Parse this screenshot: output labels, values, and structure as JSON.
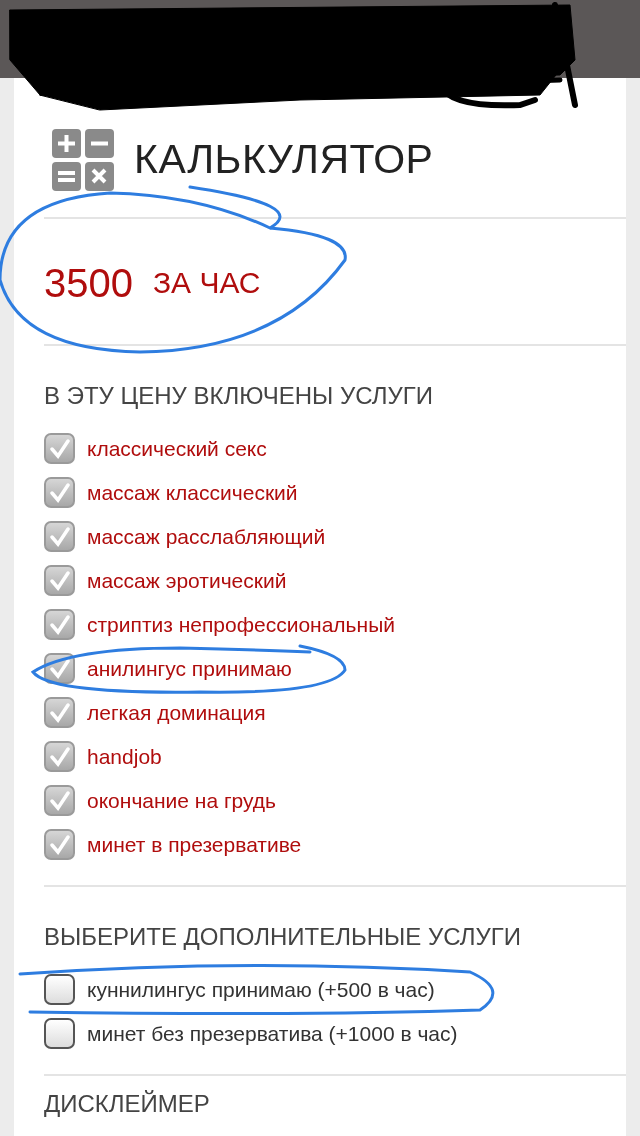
{
  "header": {
    "title": "КАЛЬКУЛЯТОР"
  },
  "price": {
    "amount": "3500",
    "unit": "ЗА ЧАС"
  },
  "included": {
    "heading": "В ЭТУ ЦЕНУ ВКЛЮЧЕНЫ УСЛУГИ",
    "items": [
      {
        "label": "классический секс",
        "checked": true
      },
      {
        "label": "массаж классический",
        "checked": true
      },
      {
        "label": "массаж расслабляющий",
        "checked": true
      },
      {
        "label": "массаж эротический",
        "checked": true
      },
      {
        "label": "стриптиз непрофессиональный",
        "checked": true
      },
      {
        "label": "анилингус принимаю",
        "checked": true
      },
      {
        "label": "легкая доминация",
        "checked": true
      },
      {
        "label": "handjob",
        "checked": true
      },
      {
        "label": "окончание на грудь",
        "checked": true
      },
      {
        "label": "минет в презервативе",
        "checked": true
      }
    ]
  },
  "extras": {
    "heading": "ВЫБЕРИТЕ ДОПОЛНИТЕЛЬНЫЕ УСЛУГИ",
    "items": [
      {
        "label": "куннилингус принимаю (+500 в час)",
        "checked": false
      },
      {
        "label": "минет без презерватива (+1000 в час)",
        "checked": false
      }
    ]
  },
  "disclaimer": {
    "heading": "ДИСКЛЕЙМЕР"
  }
}
